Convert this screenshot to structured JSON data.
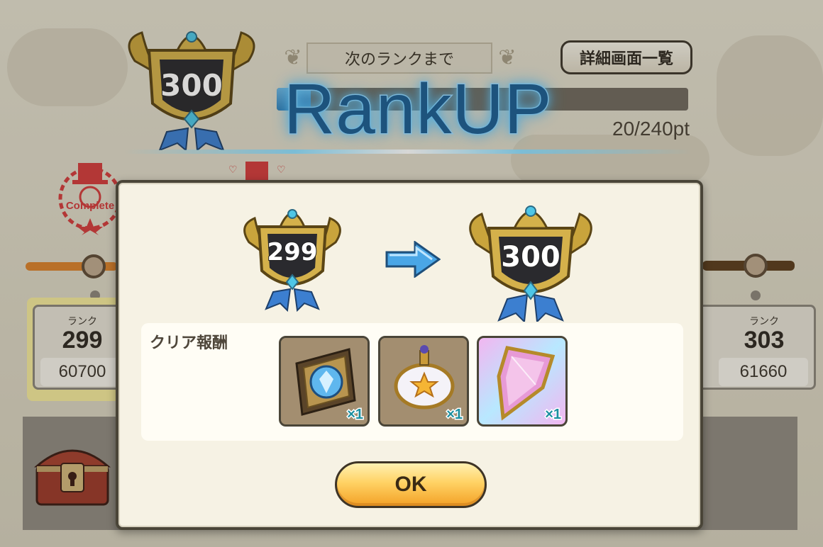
{
  "header": {
    "current_rank_badge": "300",
    "next_rank_label": "次のランクまで",
    "detail_button_label": "詳細画面一覧",
    "rankup_title": "RankUP",
    "progress_text": "20/240pt",
    "progress_fraction": 0.0833
  },
  "stamps": [
    {
      "text": "Complete"
    },
    {
      "text": ""
    }
  ],
  "side_cards": {
    "left": {
      "rank_label": "ランク",
      "rank_value": "299",
      "score": "60700"
    },
    "right": {
      "rank_label": "ランク",
      "rank_value": "303",
      "score": "61660"
    }
  },
  "modal": {
    "from_rank": "299",
    "to_rank": "300",
    "reward_label": "クリア報酬",
    "rewards": [
      {
        "icon": "sapphire-tile-icon",
        "qty": "×1"
      },
      {
        "icon": "star-orb-icon",
        "qty": "×1"
      },
      {
        "icon": "pink-crystal-icon",
        "qty": "×1"
      }
    ],
    "ok_label": "OK"
  },
  "colors": {
    "modal_bg": "#f6f2e4",
    "ok_button": "#ffd264",
    "rankup_glow": "#6cd0ff",
    "qty_text": "#1a8fa0"
  }
}
